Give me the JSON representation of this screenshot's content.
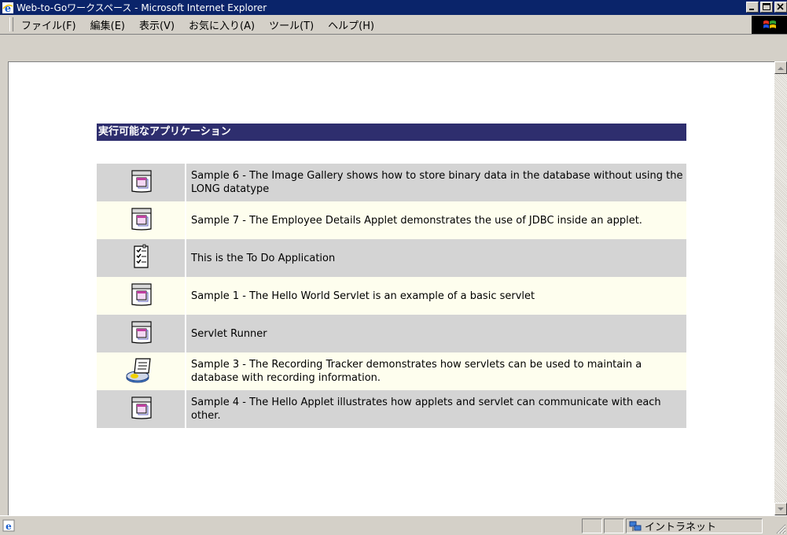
{
  "window": {
    "title": "Web-to-Goワークスペース - Microsoft Internet Explorer",
    "controls": [
      "minimize",
      "maximize",
      "close"
    ]
  },
  "menu": {
    "items": [
      "ファイル(F)",
      "編集(E)",
      "表示(V)",
      "お気に入り(A)",
      "ツール(T)",
      "ヘルプ(H)"
    ]
  },
  "page": {
    "section_title": "実行可能なアプリケーション",
    "apps": [
      {
        "icon": "applet-window-icon",
        "label": "Sample 6 - The Image Gallery shows how to store binary data in the database without using the LONG datatype"
      },
      {
        "icon": "applet-window-icon",
        "label": "Sample 7 - The Employee Details Applet demonstrates the use of JDBC inside an applet."
      },
      {
        "icon": "todo-list-icon",
        "label": "This is the To Do Application"
      },
      {
        "icon": "applet-window-icon",
        "label": "Sample 1 - The Hello World Servlet is an example of a basic servlet"
      },
      {
        "icon": "applet-window-icon",
        "label": "Servlet Runner"
      },
      {
        "icon": "database-record-icon",
        "label": "Sample 3 - The Recording Tracker demonstrates how servlets can be used to maintain a database with recording information."
      },
      {
        "icon": "applet-window-icon",
        "label": "Sample 4 - The Hello Applet illustrates how applets and servlet can communicate with each other."
      }
    ]
  },
  "status": {
    "text": "",
    "zone": "イントラネット"
  },
  "colors": {
    "titlebar": "#0a246a",
    "section_header": "#2e2e6e",
    "row_odd": "#d4d4d4",
    "row_even": "#fefeee",
    "chrome": "#d4d0c8"
  }
}
